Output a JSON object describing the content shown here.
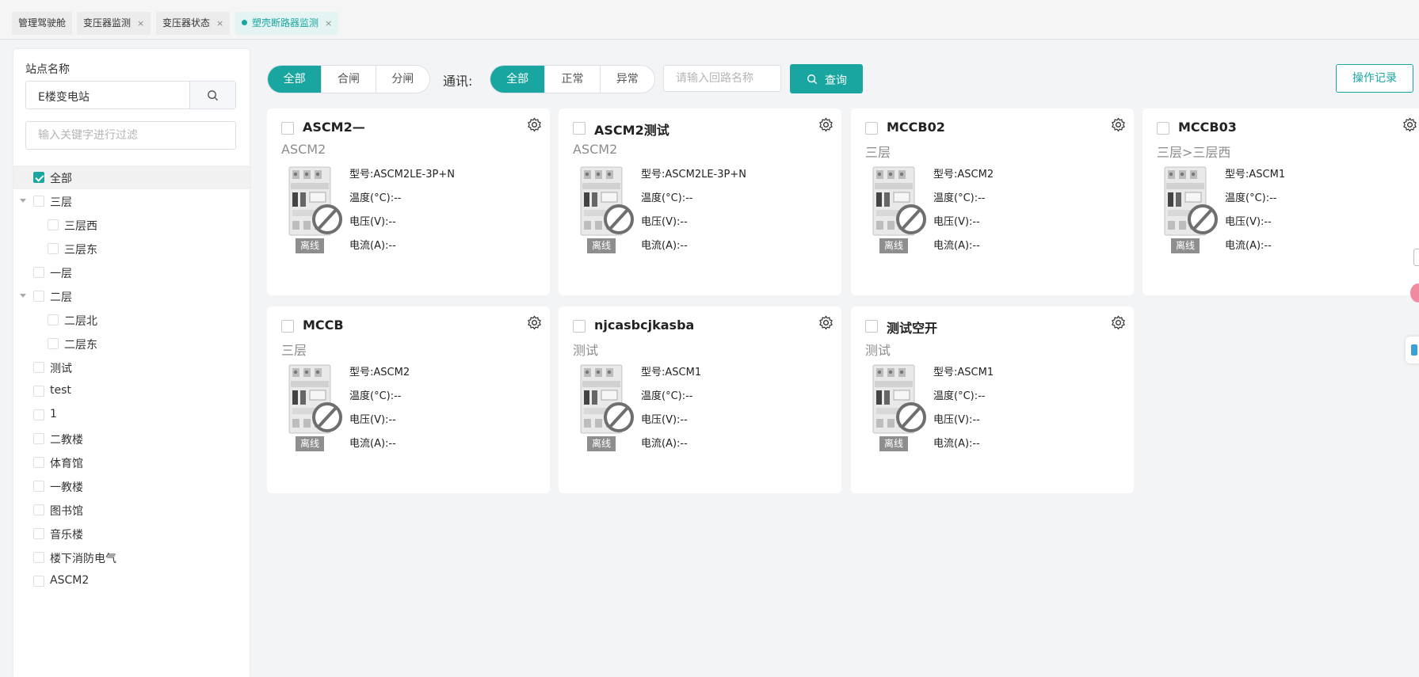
{
  "tabs": [
    {
      "label": "管理驾驶舱",
      "closable": false,
      "active": false
    },
    {
      "label": "变压器监测",
      "closable": true,
      "active": false
    },
    {
      "label": "变压器状态",
      "closable": true,
      "active": false
    },
    {
      "label": "塑壳断路器监测",
      "closable": true,
      "active": true
    }
  ],
  "close_glyph": "×",
  "left_panel": {
    "station_label": "站点名称",
    "station_value": "E楼变电站",
    "filter_placeholder": "输入关键字进行过滤",
    "tree": [
      {
        "label": "全部",
        "checked": true,
        "level": 0,
        "expandable": false
      },
      {
        "label": "三层",
        "checked": false,
        "level": 0,
        "expandable": true
      },
      {
        "label": "三层西",
        "checked": false,
        "level": 1,
        "expandable": false
      },
      {
        "label": "三层东",
        "checked": false,
        "level": 1,
        "expandable": false
      },
      {
        "label": "一层",
        "checked": false,
        "level": 0,
        "expandable": false
      },
      {
        "label": "二层",
        "checked": false,
        "level": 0,
        "expandable": true
      },
      {
        "label": "二层北",
        "checked": false,
        "level": 1,
        "expandable": false
      },
      {
        "label": "二层东",
        "checked": false,
        "level": 1,
        "expandable": false
      },
      {
        "label": "测试",
        "checked": false,
        "level": 0,
        "expandable": false
      },
      {
        "label": "test",
        "checked": false,
        "level": 0,
        "expandable": false
      },
      {
        "label": "1",
        "checked": false,
        "level": 0,
        "expandable": false
      },
      {
        "label": "二教楼",
        "checked": false,
        "level": 0,
        "expandable": false
      },
      {
        "label": "体育馆",
        "checked": false,
        "level": 0,
        "expandable": false
      },
      {
        "label": "一教楼",
        "checked": false,
        "level": 0,
        "expandable": false
      },
      {
        "label": "图书馆",
        "checked": false,
        "level": 0,
        "expandable": false
      },
      {
        "label": "音乐楼",
        "checked": false,
        "level": 0,
        "expandable": false
      },
      {
        "label": "楼下消防电气",
        "checked": false,
        "level": 0,
        "expandable": false
      },
      {
        "label": "ASCM2",
        "checked": false,
        "level": 0,
        "expandable": false
      }
    ]
  },
  "toolbar": {
    "switch_filter": [
      {
        "label": "全部",
        "active": true
      },
      {
        "label": "合闸",
        "active": false
      },
      {
        "label": "分闸",
        "active": false
      }
    ],
    "comm_label": "通讯:",
    "comm_filter": [
      {
        "label": "全部",
        "active": true
      },
      {
        "label": "正常",
        "active": false
      },
      {
        "label": "异常",
        "active": false
      }
    ],
    "circuit_placeholder": "请输入回路名称",
    "query_label": "查询",
    "oplog_label": "操作记录"
  },
  "field_labels": {
    "model": "型号:",
    "temp": "温度(°C):",
    "voltage": "电压(V):",
    "current": "电流(A):"
  },
  "cards": [
    {
      "name": "ASCM2—",
      "location": "ASCM2",
      "model": "ASCM2LE-3P+N",
      "temp": "--",
      "voltage": "--",
      "current": "--",
      "status": "离线"
    },
    {
      "name": "ASCM2测试",
      "location": "ASCM2",
      "model": "ASCM2LE-3P+N",
      "temp": "--",
      "voltage": "--",
      "current": "--",
      "status": "离线"
    },
    {
      "name": "MCCB02",
      "location": "三层",
      "model": "ASCM2",
      "temp": "--",
      "voltage": "--",
      "current": "--",
      "status": "离线"
    },
    {
      "name": "MCCB03",
      "location": "三层>三层西",
      "model": "ASCM1",
      "temp": "--",
      "voltage": "--",
      "current": "--",
      "status": "离线"
    },
    {
      "name": "MCCB",
      "location": "三层",
      "model": "ASCM2",
      "temp": "--",
      "voltage": "--",
      "current": "--",
      "status": "离线"
    },
    {
      "name": "njcasbcjkasba",
      "location": "测试",
      "model": "ASCM1",
      "temp": "--",
      "voltage": "--",
      "current": "--",
      "status": "离线"
    },
    {
      "name": "测试空开",
      "location": "测试",
      "model": "ASCM1",
      "temp": "--",
      "voltage": "--",
      "current": "--",
      "status": "离线"
    }
  ],
  "colors": {
    "accent": "#1aa6a0",
    "offline_badge": "#8e8e8e",
    "page_bg": "#f3f4f6"
  },
  "icons": [
    "search-icon",
    "gear-icon",
    "breaker-offline-icon",
    "check-icon"
  ]
}
